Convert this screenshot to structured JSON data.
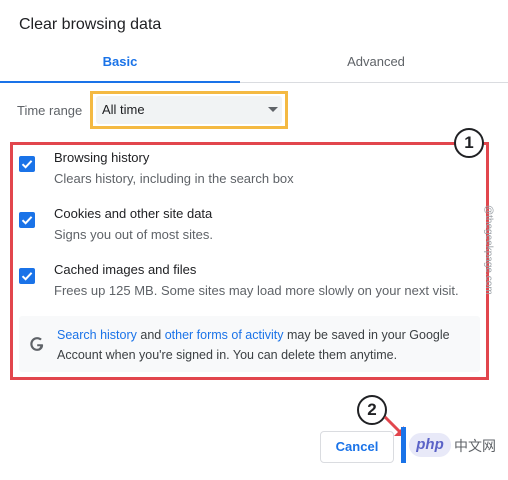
{
  "dialog": {
    "title": "Clear browsing data"
  },
  "tabs": [
    {
      "label": "Basic",
      "selected": true
    },
    {
      "label": "Advanced",
      "selected": false
    }
  ],
  "time_range": {
    "label": "Time range",
    "value": "All time"
  },
  "options": [
    {
      "title": "Browsing history",
      "description": "Clears history, including in the search box",
      "checked": true
    },
    {
      "title": "Cookies and other site data",
      "description": "Signs you out of most sites.",
      "checked": true
    },
    {
      "title": "Cached images and files",
      "description": "Frees up 125 MB. Some sites may load more slowly on your next visit.",
      "checked": true
    }
  ],
  "info": {
    "link_search_history": "Search history",
    "text_and": " and ",
    "link_other_activity": "other forms of activity",
    "text_rest": " may be saved in your Google Account when you're signed in. You can delete them anytime."
  },
  "annotations": {
    "badge_1": "1",
    "badge_2": "2",
    "highlight_color": "#e2464d",
    "dropdown_highlight_color": "#f4b942"
  },
  "buttons": {
    "cancel": "Cancel"
  },
  "watermark": "@thegeekpage.com",
  "overlay": {
    "php_label": "php",
    "php_cn": "中文网"
  },
  "colors": {
    "accent": "#1a73e8"
  }
}
